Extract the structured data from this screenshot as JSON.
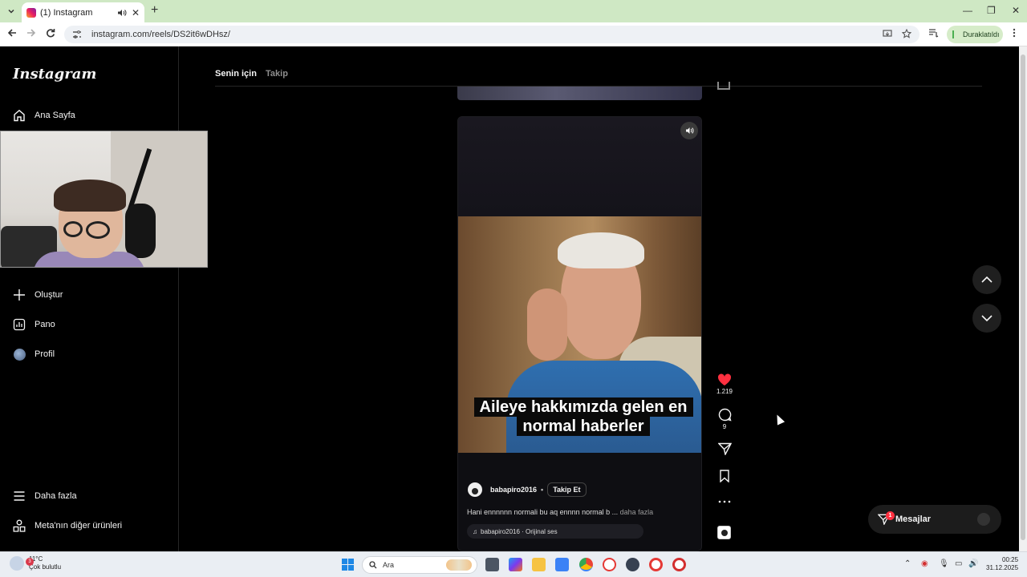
{
  "browser": {
    "tab_title": "(1) Instagram",
    "url": "instagram.com/reels/DS2it6wDHsz/",
    "profile_status": "Duraklatıldı"
  },
  "sidebar": {
    "logo": "Instagram",
    "items": [
      {
        "label": "Ana Sayfa",
        "icon": "home-icon"
      },
      {
        "label": "Oluştur",
        "icon": "plus-icon"
      },
      {
        "label": "Pano",
        "icon": "dashboard-icon"
      },
      {
        "label": "Profil",
        "icon": "avatar"
      },
      {
        "label": "Daha fazla",
        "icon": "menu-icon"
      },
      {
        "label": "Meta'nın diğer ürünleri",
        "icon": "apps-icon"
      }
    ]
  },
  "feed": {
    "tabs": [
      "Senin için",
      "Takip"
    ],
    "active_tab": "Senin için"
  },
  "reel": {
    "caption_line1": "Aileye hakkımızda gelen en",
    "caption_line2": "normal haberler",
    "author": "babapiro2016",
    "separator": "•",
    "follow_label": "Takip Et",
    "description": "Hani ennnnnn normali bu aq ennnn normal b ...",
    "more_label": "daha fazla",
    "audio": "babapiro2016 · Orijinal ses",
    "likes": "1.219",
    "comments": "9"
  },
  "messages": {
    "label": "Mesajlar",
    "badge": "1"
  },
  "taskbar": {
    "temperature": "11°C",
    "weather": "Çok bulutlu",
    "weather_badge": "3",
    "search_placeholder": "Ara",
    "time": "00:25",
    "date": "31.12.2025"
  },
  "colors": {
    "like": "#ff3040",
    "tabbar": "#cfe8c4",
    "background": "#000000"
  }
}
